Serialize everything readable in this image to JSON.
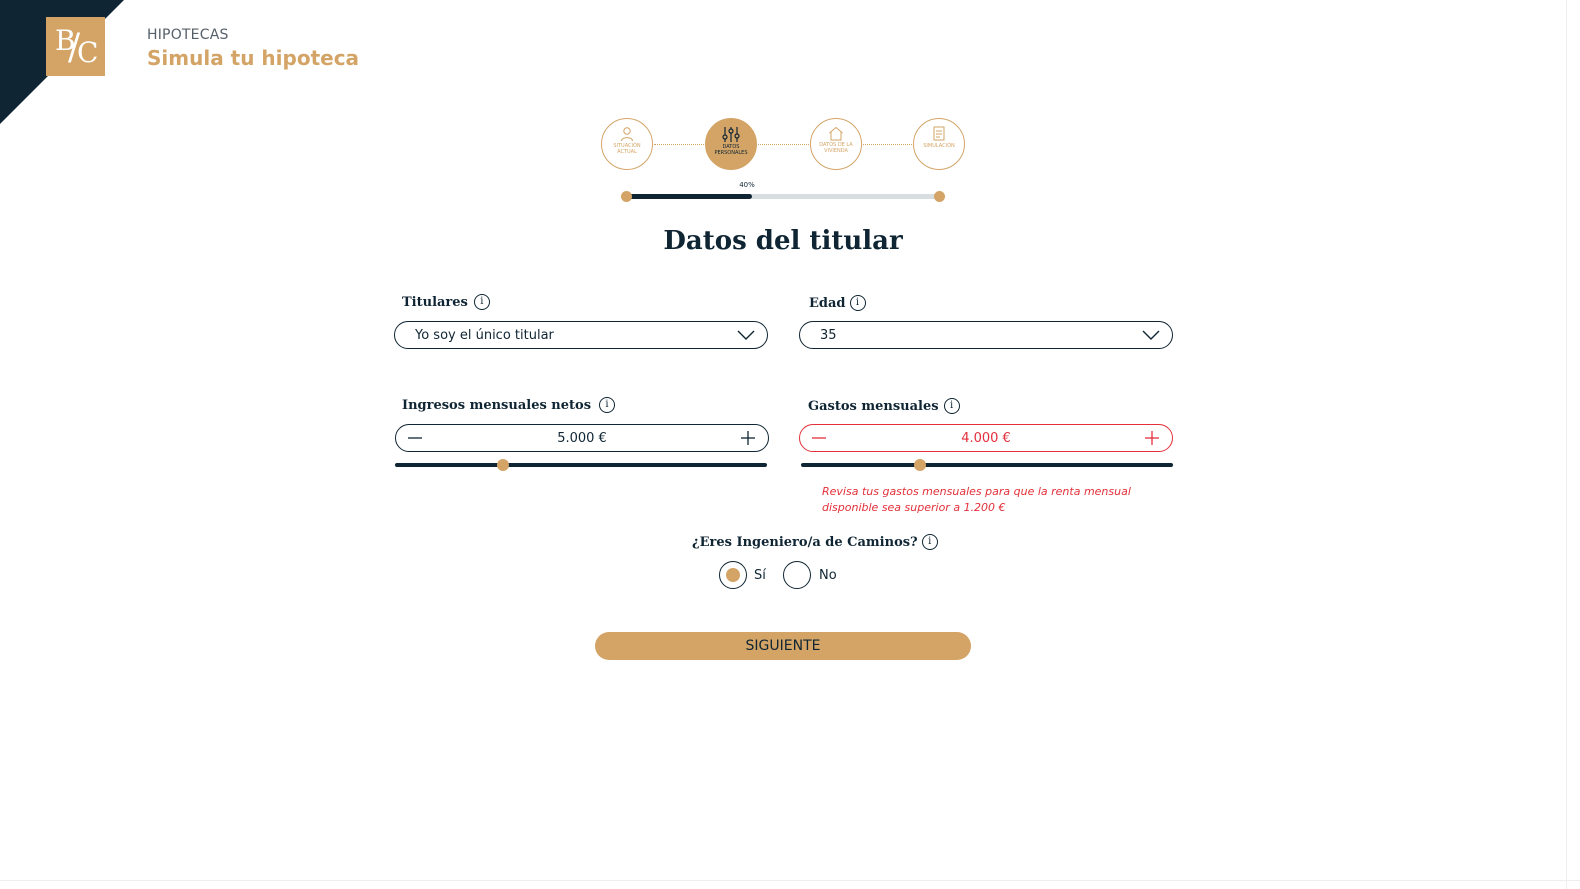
{
  "header": {
    "logo_text": "B/C",
    "section": "HIPOTECAS",
    "title": "Simula tu hipoteca"
  },
  "steps": [
    {
      "label": "SITUACIÓN ACTUAL",
      "icon": "person-icon",
      "state": "done"
    },
    {
      "label": "DATOS PERSONALES",
      "icon": "sliders-icon",
      "state": "active"
    },
    {
      "label": "DATOS DE LA VIVIENDA",
      "icon": "house-icon",
      "state": "pending"
    },
    {
      "label": "SIMULACIÓN",
      "icon": "document-icon",
      "state": "pending"
    }
  ],
  "progress": {
    "percent_label": "40%",
    "value": 0.4
  },
  "form": {
    "heading": "Datos del titular",
    "titulares": {
      "label": "Titulares",
      "value": "Yo soy el único titular"
    },
    "edad": {
      "label": "Edad",
      "value": "35"
    },
    "ingresos": {
      "label": "Ingresos mensuales netos",
      "value": "5.000 €",
      "slider_level": 0.29
    },
    "gastos": {
      "label": "Gastos mensuales",
      "value": "4.000 €",
      "slider_level": 0.32,
      "error": "Revisa tus gastos mensuales para que la renta mensual disponible sea superior a 1.200 €"
    },
    "ingeniero": {
      "question": "¿Eres Ingeniero/a de Caminos?",
      "options": [
        "Sí",
        "No"
      ],
      "selected": "Sí"
    },
    "next_label": "SIGUIENTE"
  },
  "colors": {
    "navy": "#0f2533",
    "gold": "#d3a466",
    "error": "#e3303a"
  }
}
